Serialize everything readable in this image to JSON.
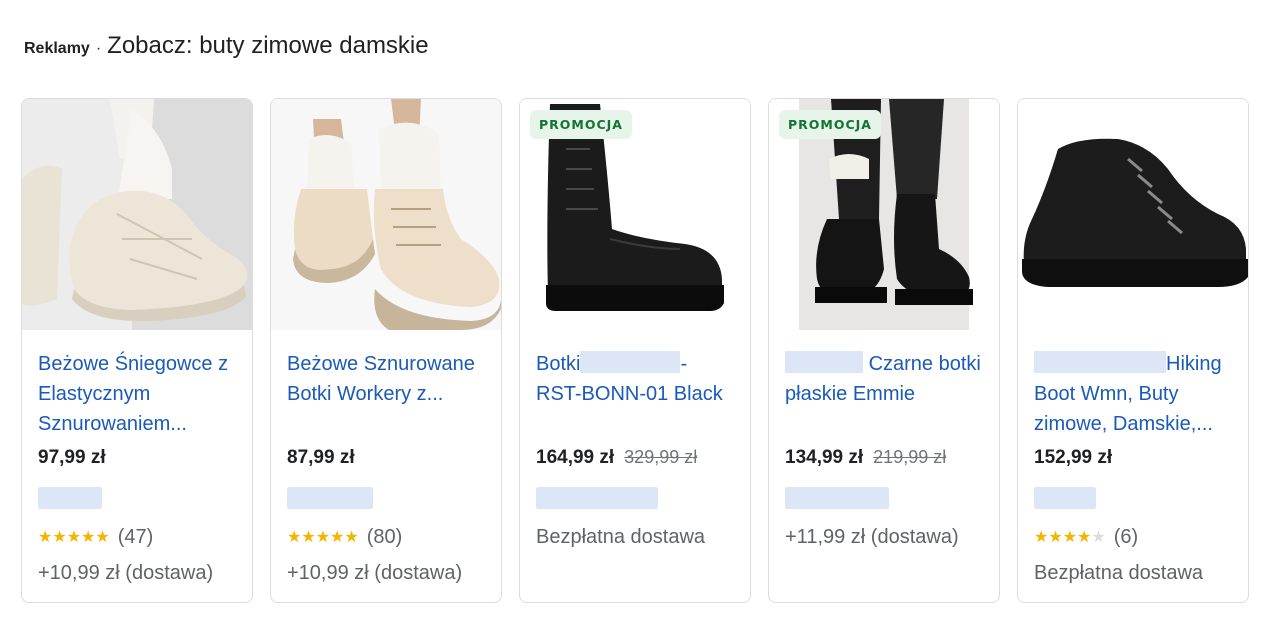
{
  "header": {
    "ads_label": "Reklamy",
    "separator": "·",
    "title": "Zobacz: buty zimowe damskie"
  },
  "cards": [
    {
      "title": "Beżowe Śniegowce z Elastycznym Sznurowaniem...",
      "price": "97,99 zł",
      "old_price": "",
      "rating_stars": 5,
      "rating_count": "(47)",
      "shipping": "+10,99 zł (dostawa)",
      "badge": ""
    },
    {
      "title": "Beżowe Sznurowane Botki Workery z...",
      "price": "87,99 zł",
      "old_price": "",
      "rating_stars": 5,
      "rating_count": "(80)",
      "shipping": "+10,99 zł (dostawa)",
      "badge": ""
    },
    {
      "title_prefix": "Botki",
      "title_suffix": "-",
      "title_line2": "RST-BONN-01 Black",
      "price": "164,99 zł",
      "old_price": "329,99 zł",
      "shipping": "Bezpłatna dostawa",
      "badge": "PROMOCJA"
    },
    {
      "title_after": "Czarne",
      "title_rest": "botki płaskie Emmie",
      "price": "134,99 zł",
      "old_price": "219,99 zł",
      "shipping": "+11,99 zł (dostawa)",
      "badge": "PROMOCJA"
    },
    {
      "title_after": "Hiking",
      "title_rest": "Boot Wmn, Buty zimowe, Damskie,...",
      "price": "152,99 zł",
      "old_price": "",
      "rating_stars": 4,
      "rating_count": "(6)",
      "shipping": "Bezpłatna dostawa",
      "badge": ""
    }
  ],
  "icons": {
    "star": "★"
  },
  "colors": {
    "link": "#1a5ab8",
    "badge_bg": "#e6f4ea",
    "badge_text": "#137333",
    "star": "#f4b400"
  }
}
